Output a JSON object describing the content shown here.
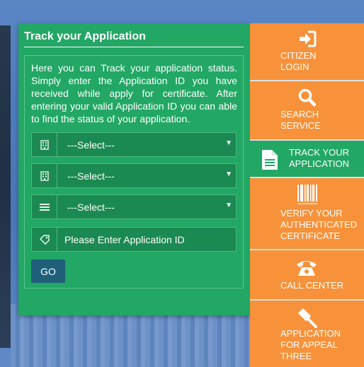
{
  "panel": {
    "title": "Track your Application",
    "description": "Here you can Track your application status. Simply enter the Application ID you have received while apply for certificate. After entering your valid Application ID you can able to find the status of your application.",
    "selects": [
      {
        "value": "---Select---",
        "icon": "building-icon"
      },
      {
        "value": "---Select---",
        "icon": "building-icon"
      },
      {
        "value": "---Select---",
        "icon": "list-icon"
      }
    ],
    "application_id": {
      "placeholder": "Please Enter Application ID",
      "icon": "tag-icon"
    },
    "go_label": "GO"
  },
  "menu": {
    "items": [
      {
        "label1": "CITIZEN",
        "label2": "LOGIN",
        "label3": "",
        "icon": "sign-in-icon"
      },
      {
        "label1": "SEARCH",
        "label2": "SERVICE",
        "label3": "",
        "icon": "search-icon"
      },
      {
        "label1": "TRACK YOUR",
        "label2": "APPLICATION",
        "label3": "",
        "icon": "document-icon"
      },
      {
        "label1": "VERIFY YOUR",
        "label2": "AUTHENTICATED",
        "label3": "CERTIFICATE",
        "icon": "barcode-icon"
      },
      {
        "label1": "CALL CENTER",
        "label2": "",
        "label3": "",
        "icon": "phone-icon"
      },
      {
        "label1": "APPLICATION",
        "label2": "FOR APPEAL",
        "label3": "THREE",
        "icon": "gavel-icon"
      }
    ]
  },
  "colors": {
    "panel_green": "#22a765",
    "menu_orange": "#f7923a",
    "field_green": "#1b8a52",
    "go_blue": "#1f5f7a"
  }
}
